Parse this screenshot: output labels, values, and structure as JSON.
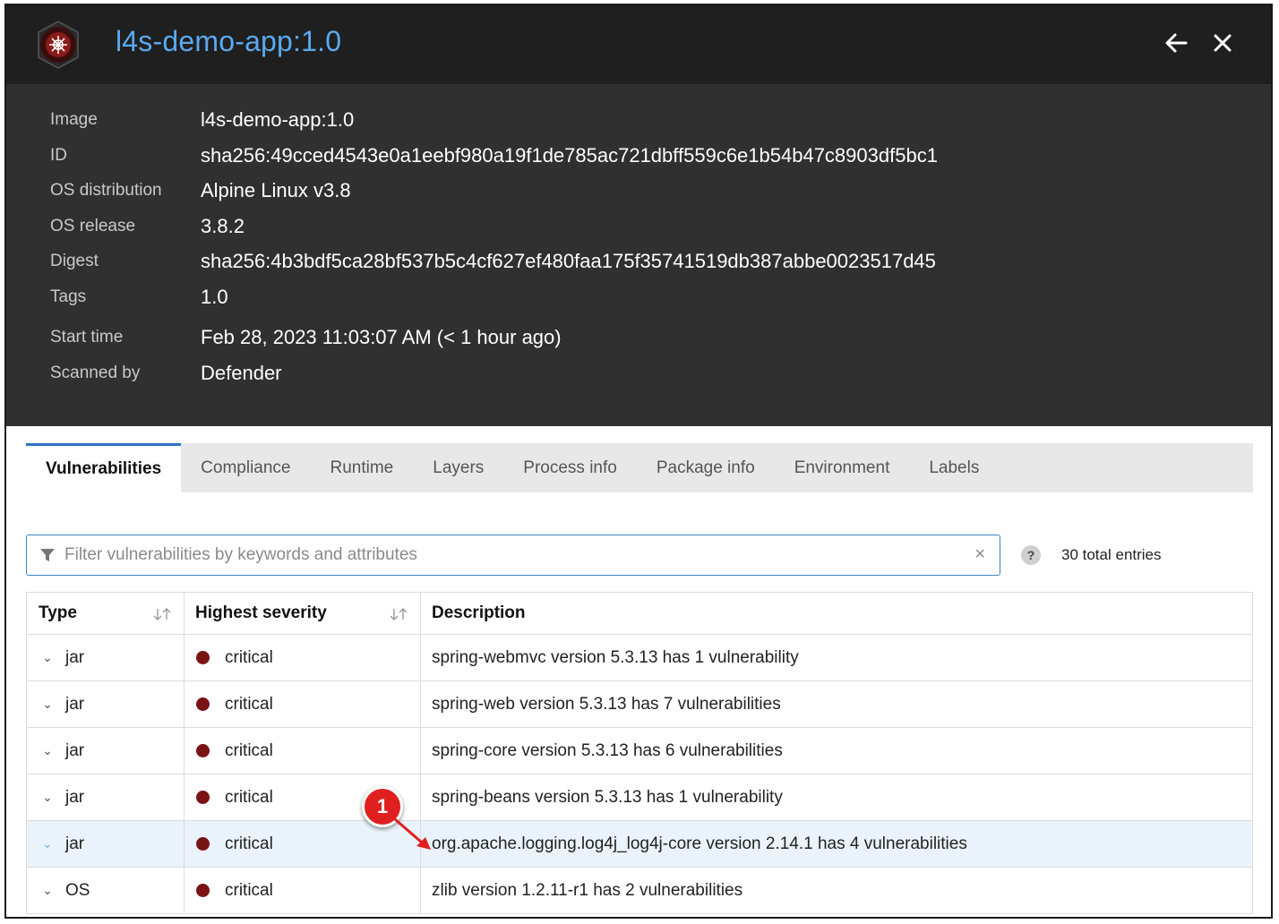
{
  "header": {
    "title": "l4s-demo-app:1.0"
  },
  "info": [
    {
      "label": "Image",
      "value": "l4s-demo-app:1.0"
    },
    {
      "label": "ID",
      "value": "sha256:49cced4543e0a1eebf980a19f1de785ac721dbff559c6e1b54b47c8903df5bc1"
    },
    {
      "label": "OS distribution",
      "value": "Alpine Linux v3.8"
    },
    {
      "label": "OS release",
      "value": "3.8.2"
    },
    {
      "label": "Digest",
      "value": "sha256:4b3bdf5ca28bf537b5c4cf627ef480faa175f35741519db387abbe0023517d45"
    },
    {
      "label": "Tags",
      "value": "1.0"
    },
    {
      "label": "Start time",
      "value": "Feb 28, 2023 11:03:07 AM (< 1 hour ago)"
    },
    {
      "label": "Scanned by",
      "value": "Defender"
    }
  ],
  "tabs": [
    {
      "label": "Vulnerabilities",
      "active": true
    },
    {
      "label": "Compliance"
    },
    {
      "label": "Runtime"
    },
    {
      "label": "Layers"
    },
    {
      "label": "Process info"
    },
    {
      "label": "Package info"
    },
    {
      "label": "Environment"
    },
    {
      "label": "Labels"
    }
  ],
  "filter": {
    "placeholder": "Filter vulnerabilities by keywords and attributes",
    "value": "",
    "clear": "×"
  },
  "help": "?",
  "total_entries": "30 total entries",
  "table": {
    "headers": {
      "type": "Type",
      "severity": "Highest severity",
      "description": "Description"
    },
    "rows": [
      {
        "type": "jar",
        "severity": "critical",
        "description": "spring-webmvc version 5.3.13 has 1 vulnerability"
      },
      {
        "type": "jar",
        "severity": "critical",
        "description": "spring-web version 5.3.13 has 7 vulnerabilities"
      },
      {
        "type": "jar",
        "severity": "critical",
        "description": "spring-core version 5.3.13 has 6 vulnerabilities"
      },
      {
        "type": "jar",
        "severity": "critical",
        "description": "spring-beans version 5.3.13 has 1 vulnerability"
      },
      {
        "type": "jar",
        "severity": "critical",
        "description": "org.apache.logging.log4j_log4j-core version 2.14.1 has 4 vulnerabilities"
      },
      {
        "type": "OS",
        "severity": "critical",
        "description": "zlib version 1.2.11-r1 has 2 vulnerabilities"
      }
    ]
  },
  "annotation": {
    "number": "1"
  },
  "colors": {
    "header_bg": "#1f1f1f",
    "info_bg": "#303030",
    "title": "#5aa9f0",
    "accent": "#2f74c0",
    "critical": "#7a1414",
    "highlight_row": "#eaf3fb",
    "callout": "#e02020"
  },
  "icons": {
    "logo": "helm-wheel-icon",
    "back": "arrow-left-icon",
    "close": "close-icon",
    "filter": "funnel-icon",
    "sort": "sort-icon",
    "expand": "chevron-down-icon"
  }
}
